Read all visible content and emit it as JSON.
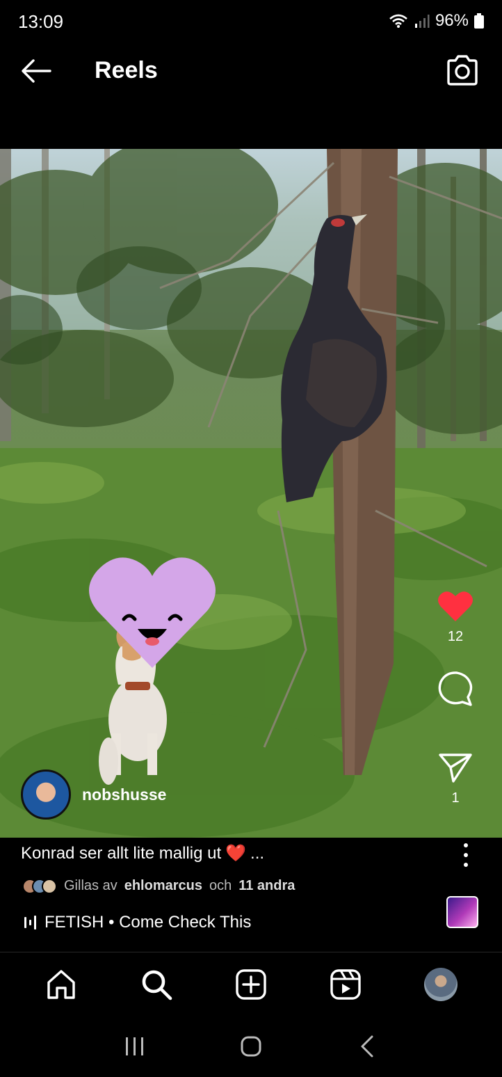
{
  "status": {
    "time": "13:09",
    "battery": "96%"
  },
  "header": {
    "title": "Reels"
  },
  "reel": {
    "author": "nobshusse",
    "likes_count": "12",
    "shares_count": "1",
    "caption_text": "Konrad ser allt lite mallig ut",
    "caption_heart": "❤️",
    "caption_more": "...",
    "liked_prefix": "Gillas av",
    "liked_user": "ehlomarcus",
    "liked_mid": "och",
    "liked_others": "11 andra",
    "music": "FETISH • Come Check This"
  },
  "colors": {
    "like_red": "#ff3040",
    "sticker": "#d4a6e8"
  },
  "icons": {
    "back": "arrow-left-icon",
    "camera": "camera-icon",
    "like": "heart-filled-icon",
    "comment": "comment-icon",
    "share": "send-icon",
    "more": "more-vertical-icon",
    "music": "music-bars-icon",
    "nav_home": "home-icon",
    "nav_search": "search-icon",
    "nav_create": "plus-square-icon",
    "nav_reels": "reels-icon",
    "nav_profile": "profile-avatar"
  }
}
